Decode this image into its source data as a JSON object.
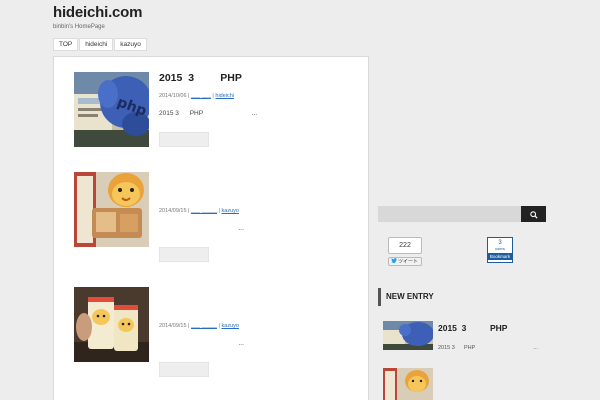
{
  "site": {
    "title": "hideichi.com",
    "description": "binbin's HomePage"
  },
  "nav": [
    "TOP",
    "hideichi",
    "kazuyo"
  ],
  "posts": [
    {
      "title": "2015  3         PHP",
      "date": "2014/10/06 | ",
      "category": "___ ___",
      "sep": " | ",
      "tag": "hideichi",
      "excerpt": "2015 3      PHP                           ..."
    },
    {
      "title": "",
      "date": "2014/09/15 | ",
      "category": "___ _____",
      "sep": " | ",
      "tag": "kazuyo",
      "excerpt": "                                            ..."
    },
    {
      "title": "",
      "date": "2014/09/15 | ",
      "category": "___ _____",
      "sep": " | ",
      "tag": "kazuyo",
      "excerpt": "                                            ..."
    }
  ],
  "sidebar": {
    "share_count": "222",
    "tweet_label": "ツイート",
    "hatena_count": "3",
    "hatena_users": "users",
    "hatena_label": "Bookmark",
    "new_entry_title": "NEW ENTRY",
    "entries": [
      {
        "title": "2015  3          PHP",
        "excerpt": "2015 3      PHP                                      ..."
      },
      {
        "title": "",
        "excerpt": ""
      }
    ]
  },
  "colors": {
    "background": "#ededed",
    "link": "#2a6fbf",
    "search_button": "#222222",
    "hatena_blue": "#1d5c9f",
    "twitter_blue": "#1da1f2"
  }
}
